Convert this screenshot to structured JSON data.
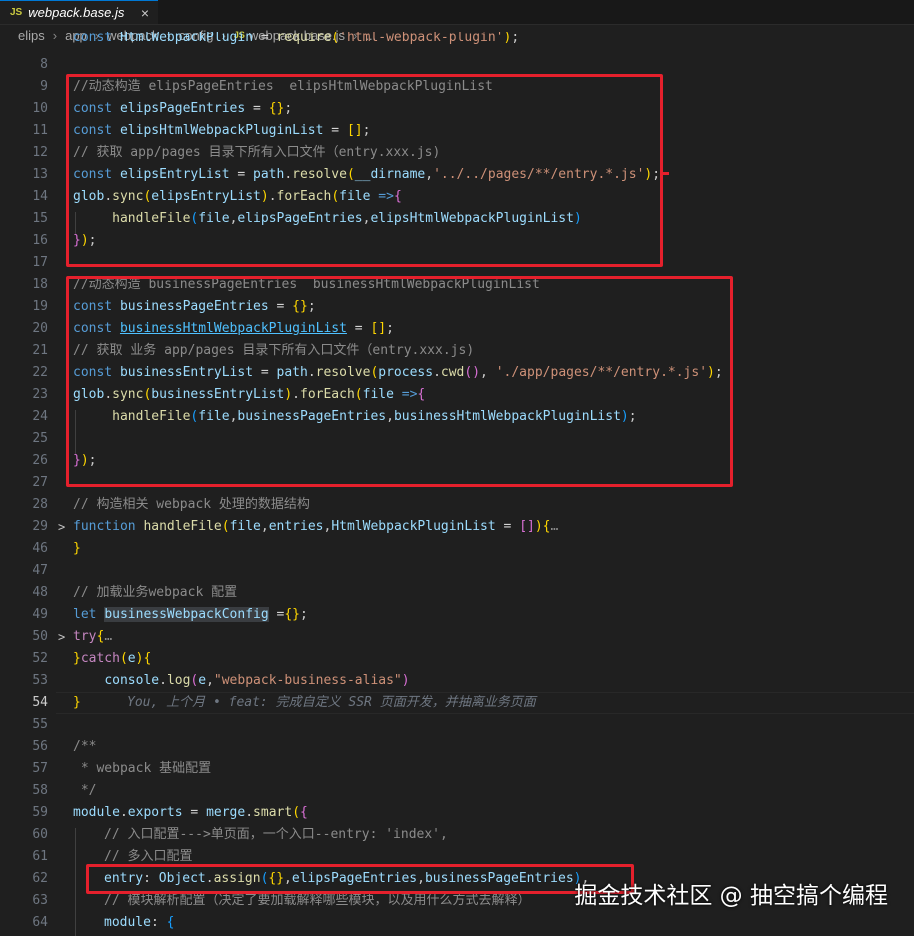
{
  "tab": {
    "file_type": "JS",
    "filename": "webpack.base.js",
    "close": "×"
  },
  "breadcrumb": [
    "elips",
    "app",
    "webpack",
    "config",
    "webpack.base.js",
    "..."
  ],
  "breadcrumb_file_type": "JS",
  "blame": "You, 上个月 • feat: 完成自定义 SSR 页面开发，并抽离业务页面",
  "watermark": "掘金技术社区 @ 抽空搞个编程",
  "colors": {
    "highlight_box": "#e5202c",
    "active_tab_border": "#0078d4"
  },
  "code": [
    {
      "n": "",
      "t": "const HtmlWebpackPlugin = require('html-webpack-plugin');"
    },
    {
      "n": "8",
      "t": ""
    },
    {
      "n": "9",
      "t": "//动态构造 elipsPageEntries  elipsHtmlWebpackPluginList"
    },
    {
      "n": "10",
      "t": "const elipsPageEntries = {};"
    },
    {
      "n": "11",
      "t": "const elipsHtmlWebpackPluginList = [];"
    },
    {
      "n": "12",
      "t": "// 获取 app/pages 目录下所有入口文件（entry.xxx.js)"
    },
    {
      "n": "13",
      "t": "const elipsEntryList = path.resolve(__dirname,'../../pages/**/entry.*.js');"
    },
    {
      "n": "14",
      "t": "glob.sync(elipsEntryList).forEach(file =>{"
    },
    {
      "n": "15",
      "t": "handleFile(file,elipsPageEntries,elipsHtmlWebpackPluginList)"
    },
    {
      "n": "16",
      "t": "});"
    },
    {
      "n": "17",
      "t": ""
    },
    {
      "n": "18",
      "t": "//动态构造 businessPageEntries  businessHtmlWebpackPluginList"
    },
    {
      "n": "19",
      "t": "const businessPageEntries = {};"
    },
    {
      "n": "20",
      "t": "const businessHtmlWebpackPluginList = [];"
    },
    {
      "n": "21",
      "t": "// 获取 业务 app/pages 目录下所有入口文件（entry.xxx.js)"
    },
    {
      "n": "22",
      "t": "const businessEntryList = path.resolve(process.cwd(), './app/pages/**/entry.*.js');"
    },
    {
      "n": "23",
      "t": "glob.sync(businessEntryList).forEach(file =>{"
    },
    {
      "n": "24",
      "t": "handleFile(file,businessPageEntries,businessHtmlWebpackPluginList);"
    },
    {
      "n": "25",
      "t": ""
    },
    {
      "n": "26",
      "t": "});"
    },
    {
      "n": "27",
      "t": ""
    },
    {
      "n": "28",
      "t": "// 构造相关 webpack 处理的数据结构"
    },
    {
      "n": "29",
      "t": "function handleFile(file,entries,HtmlWebpackPluginList = []){…"
    },
    {
      "n": "46",
      "t": "}"
    },
    {
      "n": "47",
      "t": ""
    },
    {
      "n": "48",
      "t": "// 加载业务webpack 配置"
    },
    {
      "n": "49",
      "t": "let businessWebpackConfig ={};"
    },
    {
      "n": "50",
      "t": "try{…"
    },
    {
      "n": "52",
      "t": "}catch(e){"
    },
    {
      "n": "53",
      "t": "console.log(e,\"webpack-business-alias\")"
    },
    {
      "n": "54",
      "t": "}"
    },
    {
      "n": "55",
      "t": ""
    },
    {
      "n": "56",
      "t": "/**"
    },
    {
      "n": "57",
      "t": " * webpack 基础配置"
    },
    {
      "n": "58",
      "t": " */"
    },
    {
      "n": "59",
      "t": "module.exports = merge.smart({"
    },
    {
      "n": "60",
      "t": "// 入口配置--->单页面，一个入口--entry: 'index',"
    },
    {
      "n": "61",
      "t": "// 多入口配置"
    },
    {
      "n": "62",
      "t": "entry: Object.assign({},elipsPageEntries,businessPageEntries),"
    },
    {
      "n": "63",
      "t": "// 模块解析配置（决定了要加载解释哪些模块，以及用什么方式去解释）"
    },
    {
      "n": "64",
      "t": "module: {"
    }
  ]
}
